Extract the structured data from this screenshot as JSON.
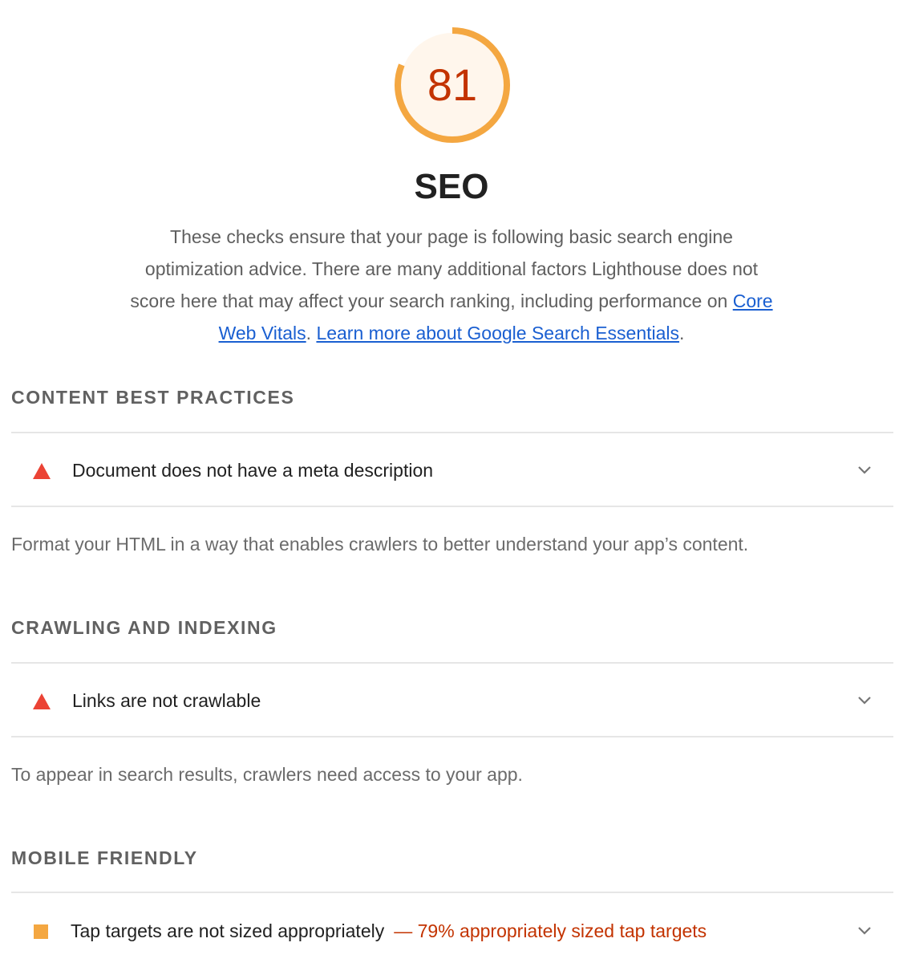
{
  "score": {
    "value": "81",
    "fraction": 0.81,
    "ring_color": "#f4a741",
    "fill_color": "#fff6ec",
    "text_color": "#c33300"
  },
  "category": {
    "title": "SEO",
    "description_text": "These checks ensure that your page is following basic search engine optimization advice. There are many additional factors Lighthouse does not score here that may affect your search ranking, including performance on ",
    "link_cwv": "Core Web Vitals",
    "sep": ". ",
    "link_learn": "Learn more about Google Search Essentials",
    "end": "."
  },
  "groups": [
    {
      "title": "CONTENT BEST PRACTICES",
      "audit": {
        "icon": "fail-triangle-icon",
        "title": "Document does not have a meta description",
        "display": ""
      },
      "description": "Format your HTML in a way that enables crawlers to better understand your app’s content."
    },
    {
      "title": "CRAWLING AND INDEXING",
      "audit": {
        "icon": "fail-triangle-icon",
        "title": "Links are not crawlable",
        "display": ""
      },
      "description": "To appear in search results, crawlers need access to your app."
    },
    {
      "title": "MOBILE FRIENDLY",
      "audit": {
        "icon": "average-square-icon",
        "title": "Tap targets are not sized appropriately",
        "display": "— 79% appropriately sized tap targets"
      }
    }
  ],
  "colors": {
    "fail": "#eb4335",
    "average": "#f4a741",
    "link": "#1a5fd1"
  }
}
